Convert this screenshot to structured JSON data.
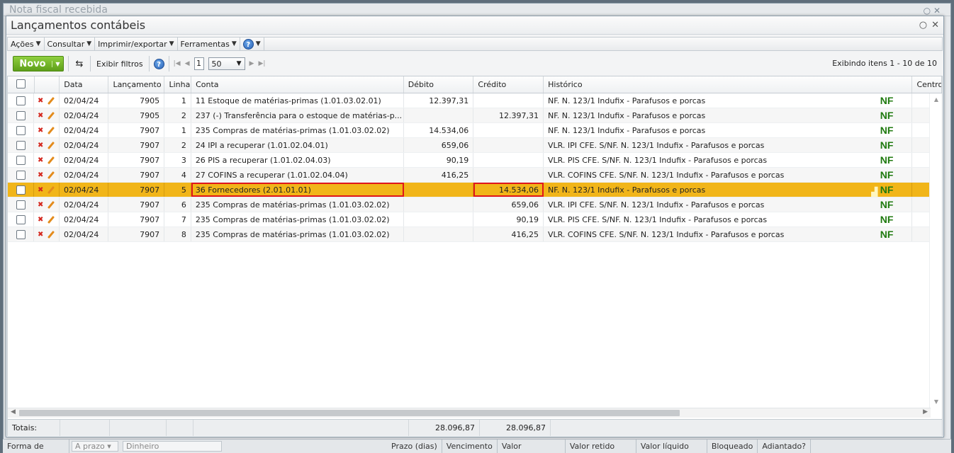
{
  "background_window": {
    "title": "Nota fiscal recebida",
    "footer": [
      "Forma de",
      "A prazo",
      "Dinheiro",
      "Prazo (dias)",
      "Vencimento",
      "Valor",
      "Valor retido",
      "Valor líquido",
      "Bloqueado",
      "Adiantado?"
    ]
  },
  "dialog": {
    "title": "Lançamentos contábeis",
    "menu": [
      "Ações",
      "Consultar",
      "Imprimir/exportar",
      "Ferramentas"
    ],
    "toolbar": {
      "new_label": "Novo",
      "filters_label": "Exibir filtros",
      "page": "1",
      "page_size": "50",
      "display_info": "Exibindo itens 1 - 10 de 10"
    },
    "columns": {
      "data": "Data",
      "lancamento": "Lançamento",
      "linha": "Linha",
      "conta": "Conta",
      "debito": "Débito",
      "credito": "Crédito",
      "historico": "Histórico",
      "centro": "Centro"
    },
    "nf_label": "NF",
    "rows": [
      {
        "data": "02/04/24",
        "lancamento": "7905",
        "linha": "1",
        "conta": "11 Estoque de matérias-primas (1.01.03.02.01)",
        "debito": "12.397,31",
        "credito": "",
        "historico": "NF. N. 123/1 Indufix - Parafusos e porcas"
      },
      {
        "data": "02/04/24",
        "lancamento": "7905",
        "linha": "2",
        "conta": "237 (-) Transferência para o estoque de matérias-p...",
        "debito": "",
        "credito": "12.397,31",
        "historico": "NF. N. 123/1 Indufix - Parafusos e porcas"
      },
      {
        "data": "02/04/24",
        "lancamento": "7907",
        "linha": "1",
        "conta": "235 Compras de matérias-primas (1.01.03.02.02)",
        "debito": "14.534,06",
        "credito": "",
        "historico": "NF. N. 123/1 Indufix - Parafusos e porcas"
      },
      {
        "data": "02/04/24",
        "lancamento": "7907",
        "linha": "2",
        "conta": "24 IPI a recuperar (1.01.02.04.01)",
        "debito": "659,06",
        "credito": "",
        "historico": "VLR. IPI CFE. S/NF. N. 123/1 Indufix - Parafusos e porcas"
      },
      {
        "data": "02/04/24",
        "lancamento": "7907",
        "linha": "3",
        "conta": "26 PIS a recuperar (1.01.02.04.03)",
        "debito": "90,19",
        "credito": "",
        "historico": "VLR. PIS CFE. S/NF. N. 123/1 Indufix - Parafusos e porcas"
      },
      {
        "data": "02/04/24",
        "lancamento": "7907",
        "linha": "4",
        "conta": "27 COFINS a recuperar (1.01.02.04.04)",
        "debito": "416,25",
        "credito": "",
        "historico": "VLR. COFINS CFE. S/NF. N. 123/1 Indufix - Parafusos e porcas"
      },
      {
        "data": "02/04/24",
        "lancamento": "7907",
        "linha": "5",
        "conta": "36 Fornecedores (2.01.01.01)",
        "debito": "",
        "credito": "14.534,06",
        "historico": "NF. N. 123/1 Indufix - Parafusos e porcas"
      },
      {
        "data": "02/04/24",
        "lancamento": "7907",
        "linha": "6",
        "conta": "235 Compras de matérias-primas (1.01.03.02.02)",
        "debito": "",
        "credito": "659,06",
        "historico": "VLR. IPI CFE. S/NF. N. 123/1 Indufix - Parafusos e porcas"
      },
      {
        "data": "02/04/24",
        "lancamento": "7907",
        "linha": "7",
        "conta": "235 Compras de matérias-primas (1.01.03.02.02)",
        "debito": "",
        "credito": "90,19",
        "historico": "VLR. PIS CFE. S/NF. N. 123/1 Indufix - Parafusos e porcas"
      },
      {
        "data": "02/04/24",
        "lancamento": "7907",
        "linha": "8",
        "conta": "235 Compras de matérias-primas (1.01.03.02.02)",
        "debito": "",
        "credito": "416,25",
        "historico": "VLR. COFINS CFE. S/NF. N. 123/1 Indufix - Parafusos e porcas"
      }
    ],
    "selected_row": 6,
    "totals": {
      "label": "Totais:",
      "debito": "28.096,87",
      "credito": "28.096,87"
    }
  },
  "colors": {
    "selected_row": "#f1b519",
    "highlight_outline": "#e0161b",
    "new_button": "#6fb325",
    "nf_text": "#1f7a0f"
  }
}
